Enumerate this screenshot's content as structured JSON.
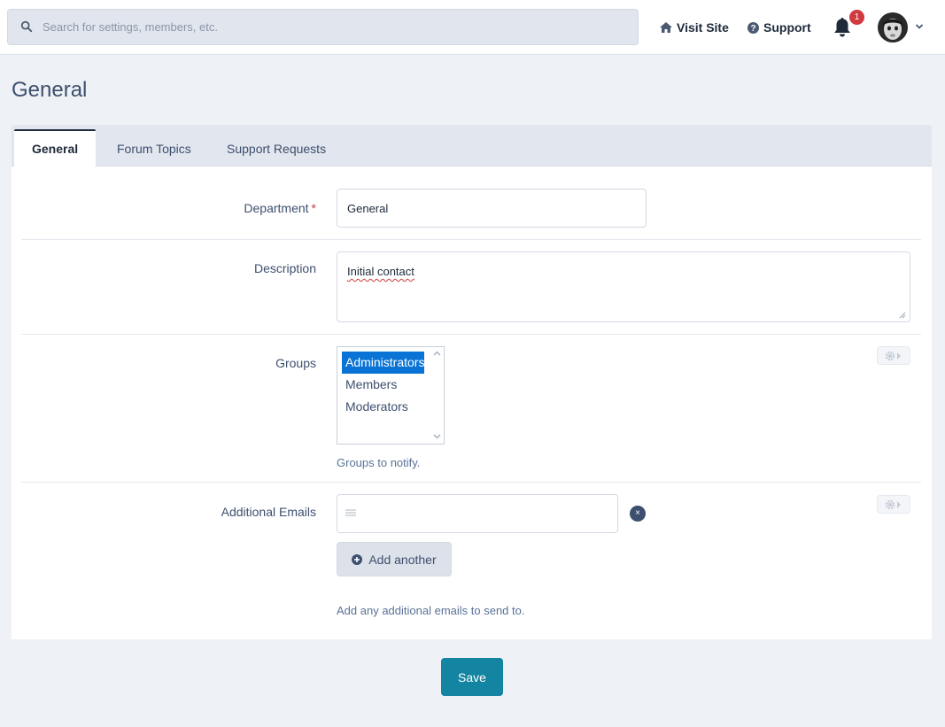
{
  "header": {
    "search_placeholder": "Search for settings, members, etc.",
    "visit_site": "Visit Site",
    "support": "Support",
    "notification_count": "1"
  },
  "page": {
    "title": "General"
  },
  "tabs": [
    {
      "label": "General",
      "active": true
    },
    {
      "label": "Forum Topics",
      "active": false
    },
    {
      "label": "Support Requests",
      "active": false
    }
  ],
  "form": {
    "department": {
      "label": "Department",
      "required_mark": "*",
      "value": "General"
    },
    "description": {
      "label": "Description",
      "value": "Initial contact"
    },
    "groups": {
      "label": "Groups",
      "options": [
        {
          "label": "Administrators",
          "selected": true
        },
        {
          "label": "Members",
          "selected": false
        },
        {
          "label": "Moderators",
          "selected": false
        }
      ],
      "help": "Groups to notify."
    },
    "additional_emails": {
      "label": "Additional Emails",
      "value": "",
      "remove_label": "×",
      "add_button": "Add another",
      "help": "Add any additional emails to send to."
    }
  },
  "footer": {
    "save_label": "Save"
  },
  "colors": {
    "accent": "#1384a1",
    "selected": "#0a74d6",
    "badge": "#d0393e"
  }
}
